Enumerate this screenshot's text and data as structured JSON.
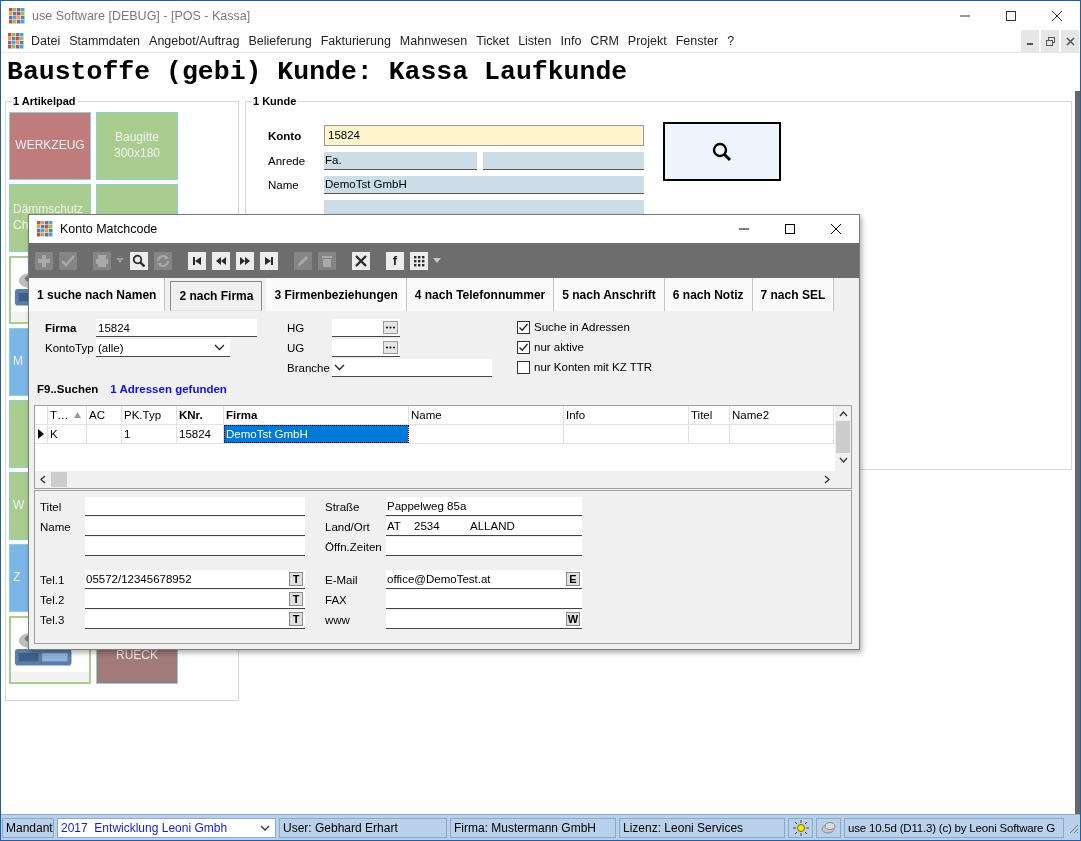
{
  "window": {
    "title": "use Software [DEBUG] - [POS - Kassa]"
  },
  "menu": {
    "items": [
      "Datei",
      "Stammdaten",
      "Angebot/Auftrag",
      "Belieferung",
      "Fakturierung",
      "Mahnwesen",
      "Ticket",
      "Listen",
      "Info",
      "CRM",
      "Projekt",
      "Fenster",
      "?"
    ]
  },
  "heading": "Baustoffe (gebi) Kunde: Kassa Laufkunde",
  "artikelpad": {
    "title": "1 Artikelpad",
    "tiles": [
      {
        "kind": "text",
        "label": "WERKZEUG",
        "color": "#c07c7c"
      },
      {
        "kind": "text",
        "label": "Baugitte 300x180",
        "color": "#a9cd8f"
      },
      {
        "kind": "cut",
        "label": "Dämmschutz Ch",
        "color": "#a9cd8f"
      },
      {
        "kind": "blank",
        "color": "#a9cd8f"
      },
      {
        "kind": "picture"
      },
      {
        "kind": "hidden"
      },
      {
        "kind": "cut",
        "label": "M",
        "color": "#7ab6e8"
      },
      {
        "kind": "hidden"
      },
      {
        "kind": "blank",
        "color": "#a9cd8f"
      },
      {
        "kind": "hidden"
      },
      {
        "kind": "cut",
        "label": "W",
        "color": "#a9cd8f"
      },
      {
        "kind": "hidden"
      },
      {
        "kind": "cut",
        "label": "Z",
        "color": "#7ab6e8"
      },
      {
        "kind": "hidden"
      },
      {
        "kind": "picture"
      },
      {
        "kind": "bottom",
        "label": "RUECK",
        "color": "#a37a7a"
      }
    ]
  },
  "kunde": {
    "title": "1 Kunde",
    "fields": [
      {
        "kind": "key",
        "label": "Konto",
        "value": "15824"
      },
      {
        "kind": "pair",
        "label": "Anrede",
        "value": "Fa."
      },
      {
        "kind": "plain",
        "label": "Name",
        "value": "DemoTst GmbH"
      },
      {
        "kind": "plain"
      }
    ]
  },
  "dialog": {
    "title": "Konto Matchcode",
    "toolbar": [
      {
        "kind": "plus",
        "disabled": true
      },
      {
        "kind": "check",
        "disabled": true
      },
      {
        "kind": "print",
        "disabled": true
      },
      {
        "kind": "caret",
        "disabled": true
      },
      {
        "kind": "search",
        "disabled": false
      },
      {
        "kind": "refresh",
        "disabled": true
      },
      {
        "kind": "first",
        "disabled": false
      },
      {
        "kind": "prev",
        "disabled": false
      },
      {
        "kind": "next",
        "disabled": false
      },
      {
        "kind": "last",
        "disabled": false
      },
      {
        "kind": "edit",
        "disabled": true
      },
      {
        "kind": "delete",
        "disabled": true
      },
      {
        "kind": "cancel",
        "disabled": false
      },
      {
        "kind": "letter",
        "label": "f",
        "disabled": false
      },
      {
        "kind": "grid",
        "disabled": false
      },
      {
        "kind": "caret",
        "disabled": false
      }
    ],
    "tabs": [
      {
        "label": "1 suche nach Namen",
        "selected": false
      },
      {
        "label": "2 nach Firma",
        "selected": true
      },
      {
        "label": "3 Firmenbeziehungen",
        "selected": false
      },
      {
        "label": "4 nach Telefonnummer",
        "selected": false
      },
      {
        "label": "5 nach Anschrift",
        "selected": false
      },
      {
        "label": "6 nach Notiz",
        "selected": false
      },
      {
        "label": "7 nach SEL",
        "selected": false
      }
    ],
    "firma": {
      "label": "Firma",
      "value": "15824"
    },
    "kontotyp": {
      "label": "KontoTyp",
      "value": "(alle)"
    },
    "hg": {
      "label": "HG"
    },
    "ug": {
      "label": "UG"
    },
    "branche": {
      "label": "Branche"
    },
    "checkboxes": [
      {
        "label": "Suche in Adressen",
        "checked": true
      },
      {
        "label": "nur aktive",
        "checked": true
      },
      {
        "label": "nur Konten mit KZ TTR",
        "checked": false
      }
    ],
    "search_hint": "F9..Suchen",
    "result_count": "1 Adressen gefunden",
    "grid": {
      "columns": [
        {
          "label": "T…",
          "bold": false,
          "sorted": true
        },
        {
          "label": "AC",
          "bold": false,
          "sorted": false
        },
        {
          "label": "PK.Typ",
          "bold": false,
          "sorted": false
        },
        {
          "label": "KNr.",
          "bold": true,
          "sorted": false
        },
        {
          "label": "Firma",
          "bold": true,
          "sorted": false
        },
        {
          "label": "Name",
          "bold": false,
          "sorted": false
        },
        {
          "label": "Info",
          "bold": false,
          "sorted": false
        },
        {
          "label": "Titel",
          "bold": false,
          "sorted": false
        },
        {
          "label": "Name2",
          "bold": false,
          "sorted": false
        }
      ],
      "rows": [
        {
          "current": true,
          "cells": [
            {
              "text": "K",
              "selected": false
            },
            {
              "text": "",
              "selected": false
            },
            {
              "text": "1",
              "selected": false
            },
            {
              "text": "15824",
              "selected": false
            },
            {
              "text": "DemoTst GmbH",
              "selected": true
            },
            {
              "text": "",
              "selected": false
            },
            {
              "text": "",
              "selected": false
            },
            {
              "text": "",
              "selected": false
            },
            {
              "text": "",
              "selected": false
            }
          ]
        }
      ]
    },
    "details": {
      "names": [
        {
          "kind": "labeled",
          "label": "Titel"
        },
        {
          "kind": "labeled",
          "label": "Name"
        },
        {
          "kind": "continuation"
        }
      ],
      "phones": [
        {
          "label": "Tel.1",
          "value": "05572/12345678952",
          "button": "T"
        },
        {
          "label": "Tel.2",
          "button": "T"
        },
        {
          "label": "Tel.3",
          "button": "T"
        }
      ],
      "address": [
        {
          "label": "Straße",
          "value": "Pappelweg 85a"
        },
        {
          "label": "Land/Ort",
          "parts": [
            "AT",
            "2534",
            "ALLAND"
          ]
        },
        {
          "label": "Öffn.Zeiten"
        }
      ],
      "online": [
        {
          "label": "E-Mail",
          "value": "office@DemoTest.at",
          "button": "E"
        },
        {
          "label": "FAX"
        },
        {
          "label": "www",
          "button": "W"
        }
      ]
    }
  },
  "status_bar": {
    "mandant_label": "Mandant",
    "mandant": "2017  Entwicklung Leoni Gmbh",
    "user": "User: Gebhard Erhart",
    "firma": "Firma: Mustermann GmbH",
    "lizenz": "Lizenz: Leoni Services",
    "version": "use 10.5d (D11.3) (c) by Leoni Software G"
  }
}
